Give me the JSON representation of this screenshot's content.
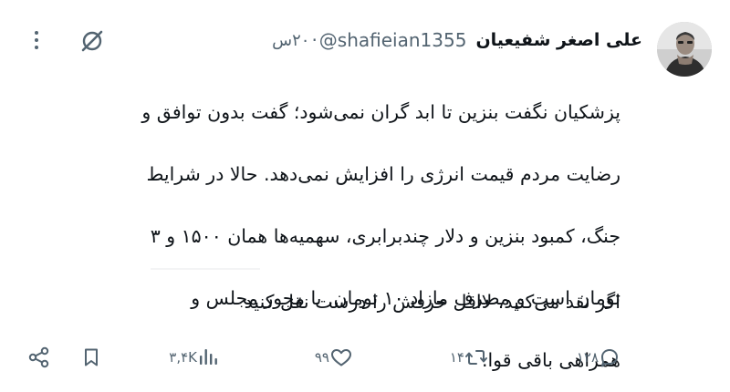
{
  "tweet": {
    "author": {
      "display_name": "علی اصغر شفیعیان",
      "handle": "@shafieian1355",
      "time_ago": "۲۰س"
    },
    "body_lines": [
      "پزشکیان نگفت بنزین تا ابد گران نمی‌شود؛ گفت بدون توافق و",
      "رضایت مردم قیمت انرژی را افزایش نمی‌دهد. حالا در شرایط",
      "جنگ، کمبود بنزین و دلار چندبرابری، سهمیه‌ها همان ۱۵۰۰ و ۳",
      "تومان است و مصرف مازاد ۱۰ تومان. با مجوز مجلس و",
      "همراهی باقی قوا."
    ],
    "closing_line": "اگر نقد می‌کنید، لااقل حرفش را درست نقل کنید",
    "actions": {
      "replies": "۱۲۸",
      "reposts": "۱۴",
      "likes": "۹۹",
      "views": "۳,۴K"
    },
    "icons": {
      "reply": "reply-icon",
      "repost": "repost-icon",
      "like": "heart-icon",
      "views": "views-chart-icon",
      "bookmark": "bookmark-icon",
      "share": "share-icon",
      "grok": "grok-icon",
      "more": "more-dots-icon"
    },
    "colors": {
      "text": "#0f1419",
      "secondary": "#536471"
    }
  }
}
